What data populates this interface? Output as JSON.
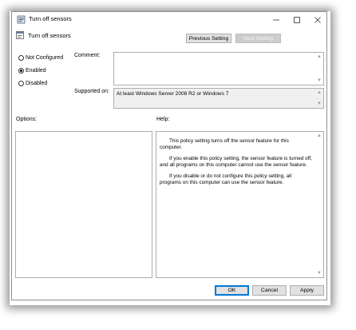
{
  "window": {
    "title": "Turn off sensors"
  },
  "heading": {
    "text": "Turn off sensors"
  },
  "nav": {
    "previous_label": "Previous Setting",
    "next_label": "Next Setting"
  },
  "state": {
    "options": [
      {
        "label": "Not Configured",
        "checked": false
      },
      {
        "label": "Enabled",
        "checked": true
      },
      {
        "label": "Disabled",
        "checked": false
      }
    ]
  },
  "comment": {
    "label": "Comment:",
    "value": ""
  },
  "supported": {
    "label": "Supported on:",
    "value": "At least Windows Server 2008 R2 or Windows 7"
  },
  "options_panel": {
    "label": "Options:"
  },
  "help": {
    "label": "Help:",
    "paragraphs": [
      "This policy setting turns off the sensor feature for this computer.",
      "If you enable this policy setting, the sensor feature is turned off, and all programs on this computer cannot use the sensor feature.",
      "If you disable or do not configure this policy setting, all programs on this computer can use the sensor feature."
    ]
  },
  "footer": {
    "ok_label": "OK",
    "cancel_label": "Cancel",
    "apply_label": "Apply"
  },
  "colors": {
    "accent": "#0078d7"
  }
}
